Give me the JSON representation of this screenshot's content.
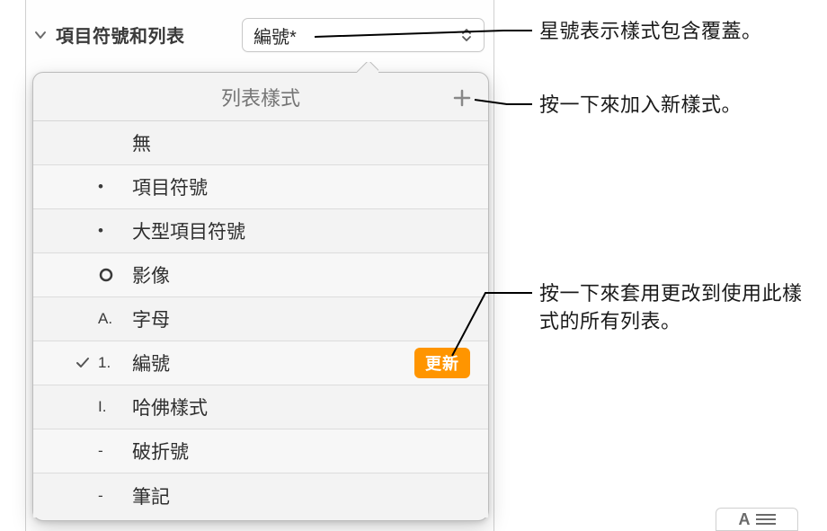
{
  "section": {
    "label": "項目符號和列表"
  },
  "dropdown": {
    "value": "編號*"
  },
  "popover": {
    "title": "列表樣式",
    "items": [
      {
        "bullet": "",
        "label": "無"
      },
      {
        "bullet": "•",
        "label": "項目符號"
      },
      {
        "bullet": "•",
        "label": "大型項目符號"
      },
      {
        "bullet": "○",
        "label": "影像"
      },
      {
        "bullet": "A.",
        "label": "字母"
      },
      {
        "bullet": "1.",
        "label": "編號",
        "checked": true,
        "update": true
      },
      {
        "bullet": "I.",
        "label": "哈佛樣式"
      },
      {
        "bullet": "-",
        "label": "破折號"
      },
      {
        "bullet": "-",
        "label": "筆記"
      }
    ],
    "update_label": "更新"
  },
  "callouts": {
    "asterisk": "星號表示樣式包含覆蓋。",
    "add_style": "按一下來加入新樣式。",
    "update_all": "按一下來套用更改到使用此樣式的所有列表。"
  }
}
